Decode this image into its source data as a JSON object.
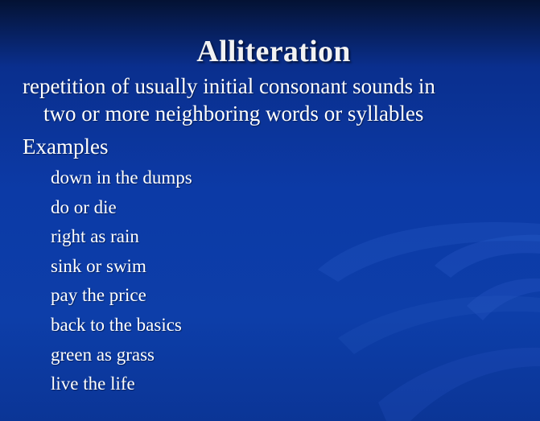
{
  "slide": {
    "title": "Alliteration",
    "definition_line1": "repetition of usually initial consonant sounds in",
    "definition_line2": "two or more neighboring words or syllables",
    "examples_heading": "Examples",
    "examples": [
      "down in the dumps",
      "do or die",
      "right as rain",
      "sink or swim",
      "pay the price",
      "back to the basics",
      "green as grass",
      "live the life"
    ]
  },
  "colors": {
    "background_top": "#041233",
    "background_main": "#0c3aa6",
    "text": "#ffffff"
  }
}
